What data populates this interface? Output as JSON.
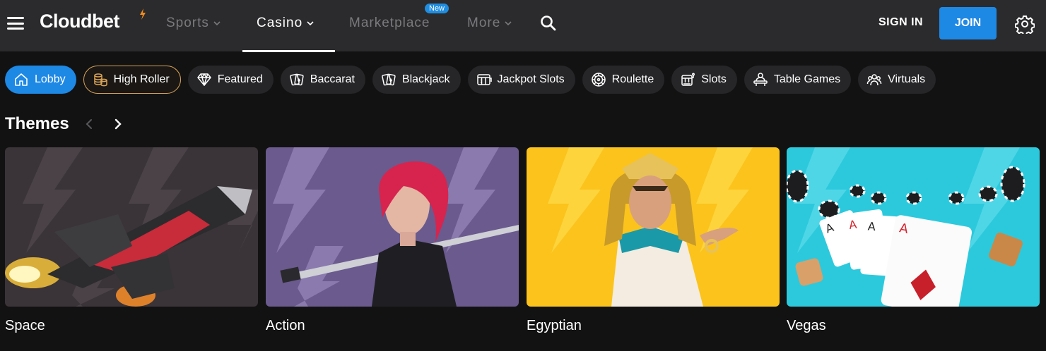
{
  "header": {
    "logo_text": "Cloudbet",
    "nav": [
      {
        "label": "Sports"
      },
      {
        "label": "Casino"
      },
      {
        "label": "Marketplace",
        "badge": "New"
      },
      {
        "label": "More"
      }
    ],
    "sign_in_label": "SIGN IN",
    "join_label": "JOIN"
  },
  "categories": [
    {
      "label": "Lobby",
      "icon": "home-icon"
    },
    {
      "label": "High Roller",
      "icon": "coins-icon"
    },
    {
      "label": "Featured",
      "icon": "diamond-icon"
    },
    {
      "label": "Baccarat",
      "icon": "cards-icon"
    },
    {
      "label": "Blackjack",
      "icon": "cards-icon"
    },
    {
      "label": "Jackpot Slots",
      "icon": "jackpot-icon"
    },
    {
      "label": "Roulette",
      "icon": "roulette-icon"
    },
    {
      "label": "Slots",
      "icon": "slot-machine-icon"
    },
    {
      "label": "Table Games",
      "icon": "dealer-icon"
    },
    {
      "label": "Virtuals",
      "icon": "virtuals-icon"
    }
  ],
  "themes": {
    "title": "Themes",
    "cards": [
      {
        "label": "Space"
      },
      {
        "label": "Action"
      },
      {
        "label": "Egyptian"
      },
      {
        "label": "Vegas"
      }
    ]
  },
  "colors": {
    "accent": "#1e88e5",
    "header_bg": "#2b2b2d",
    "page_bg": "#121212",
    "high_roller_border": "#d9a457"
  }
}
